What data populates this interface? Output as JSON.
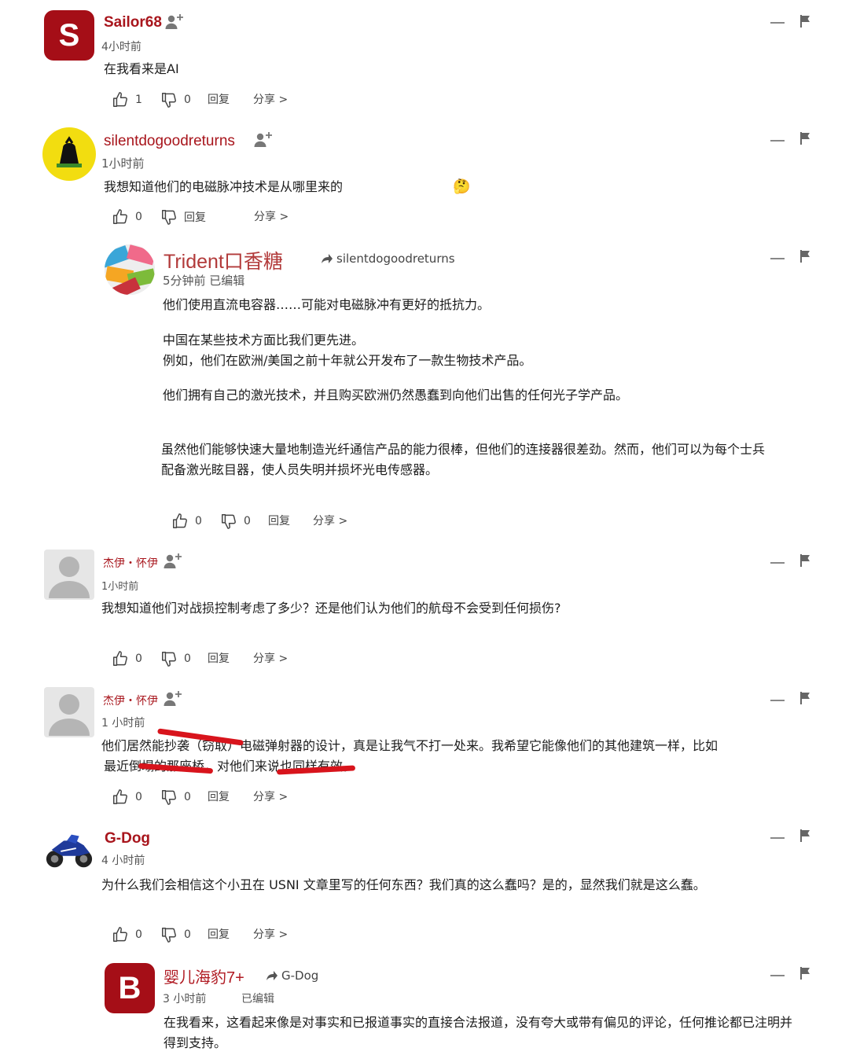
{
  "comments": [
    {
      "avatar_letter": "S",
      "username": "Sailor68",
      "time": "4小时前",
      "text": [
        "在我看来是AI"
      ],
      "likes": "1",
      "dislikes": "0",
      "reply": "回复",
      "share": "分享 >"
    },
    {
      "username": "silentdogoodreturns",
      "time": "1小时前",
      "text": [
        "我想知道他们的电磁脉冲技术是从哪里来的"
      ],
      "emoji": "🤔",
      "likes": "0",
      "reply": "回复",
      "share": "分享 >"
    },
    {
      "username": "Trident口香糖",
      "reply_to": "silentdogoodreturns",
      "time": "5分钟前 已编辑",
      "text": [
        "他们使用直流电容器……可能对电磁脉冲有更好的抵抗力。",
        "中国在某些技术方面比我们更先进。",
        "例如，他们在欧洲/美国之前十年就公开发布了一款生物技术产品。",
        "他们拥有自己的激光技术，并且购买欧洲仍然愚蠢到向他们出售的任何光子学产品。",
        "虽然他们能够快速大量地制造光纤通信产品的能力很棒，但他们的连接器很差劲。然而，他们可以为每个士兵",
        "配备激光眩目器，使人员失明并损坏光电传感器。"
      ],
      "likes": "0",
      "dislikes": "0",
      "reply": "回复",
      "share": "分享 >"
    },
    {
      "username": "杰伊・怀伊",
      "time": "1小时前",
      "text": [
        "我想知道他们对战损控制考虑了多少？还是他们认为他们的航母不会受到任何损伤?"
      ],
      "likes": "0",
      "dislikes": "0",
      "reply": "回复",
      "share": "分享 >"
    },
    {
      "username": "杰伊・怀伊",
      "time": "1 小时前",
      "text": [
        "他们居然能抄袭（窃取）电磁弹射器的设计，真是让我气不打一处来。我希望它能像他们的其他建筑一样，比如",
        "最近倒塌的那座桥，对他们来说也同样有效。"
      ],
      "likes": "0",
      "dislikes": "0",
      "reply": "回复",
      "share": "分享 >"
    },
    {
      "username": "G-Dog",
      "time": "4 小时前",
      "text": [
        "为什么我们会相信这个小丑在 USNI 文章里写的任何东西？我们真的这么蠢吗？是的，显然我们就是这么蠢。"
      ],
      "likes": "0",
      "dislikes": "0",
      "reply": "回复",
      "share": "分享 >"
    },
    {
      "avatar_letter": "B",
      "username": "婴儿海豹7+",
      "reply_to": "G-Dog",
      "time": "3 小时前",
      "edited": "已编辑",
      "text": [
        "在我看来，这看起来像是对事实和已报道事实的直接合法报道，没有夸大或带有偏见的评论，任何推论都已注明并",
        "得到支持。"
      ]
    }
  ],
  "colors": {
    "username": "#a8151c",
    "avatar_red": "#a50e17",
    "annotation": "#d8141c"
  },
  "icons": [
    "follow-icon",
    "thumb-up-icon",
    "thumb-down-icon",
    "flag-icon",
    "reply-arrow-icon"
  ]
}
